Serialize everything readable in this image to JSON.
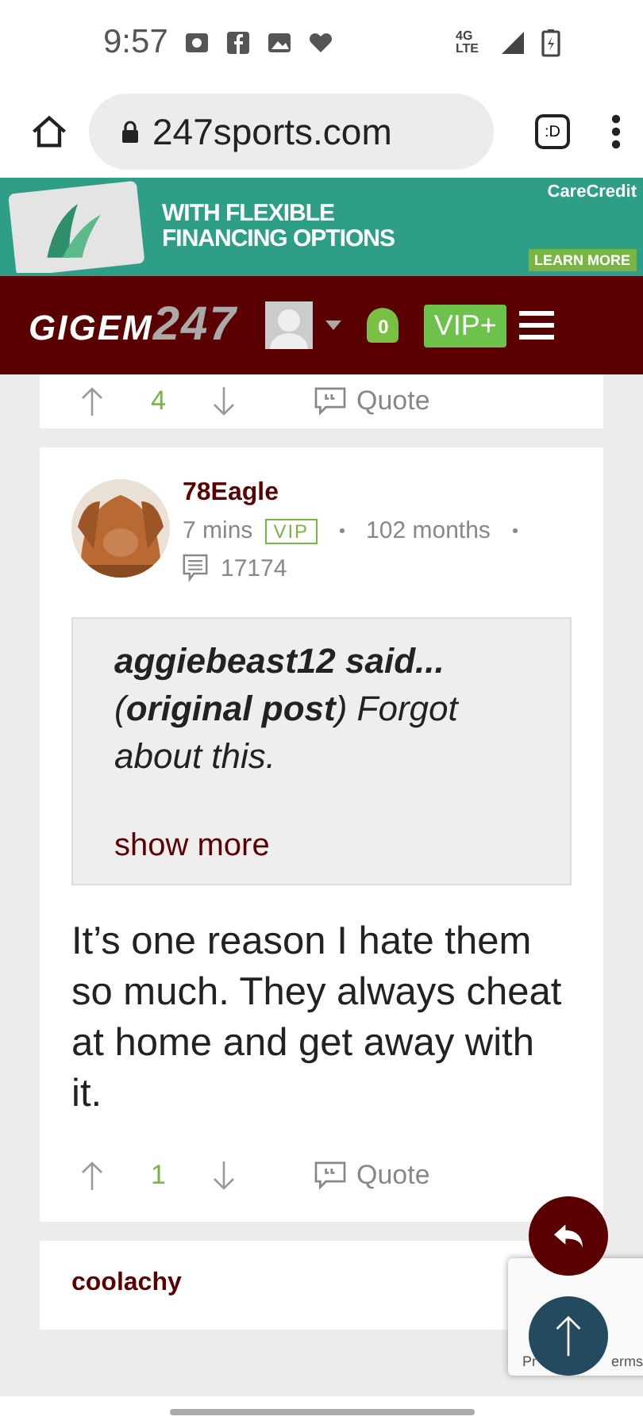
{
  "status_bar": {
    "time": "9:57",
    "network": "4G LTE"
  },
  "browser": {
    "url": "247sports.com",
    "tab_label": ":D"
  },
  "ad": {
    "headline": "WITH FLEXIBLE FINANCING OPTIONS",
    "brand": "CareCredit",
    "cta": "LEARN MORE"
  },
  "site_header": {
    "logo_word": "GIGEM",
    "logo_number": "247",
    "notifications": "0",
    "vip_label": "VIP+"
  },
  "previous_post": {
    "votes": "4",
    "quote_label": "Quote"
  },
  "post": {
    "author": "78Eagle",
    "time": "7 mins",
    "badge": "VIP",
    "tenure": "102 months",
    "post_count": "17174",
    "quote": {
      "text": "**aggiebeast12 said...** (**original post**) Forgot about this.",
      "show_more": "show more"
    },
    "body": "It’s one reason I hate them so much. They always cheat at home and get away with it.",
    "votes": "1",
    "quote_label": "Quote"
  },
  "next_post": {
    "author": "coolachy"
  },
  "recaptcha": {
    "left_text": "Pr",
    "right_text": "erms"
  }
}
